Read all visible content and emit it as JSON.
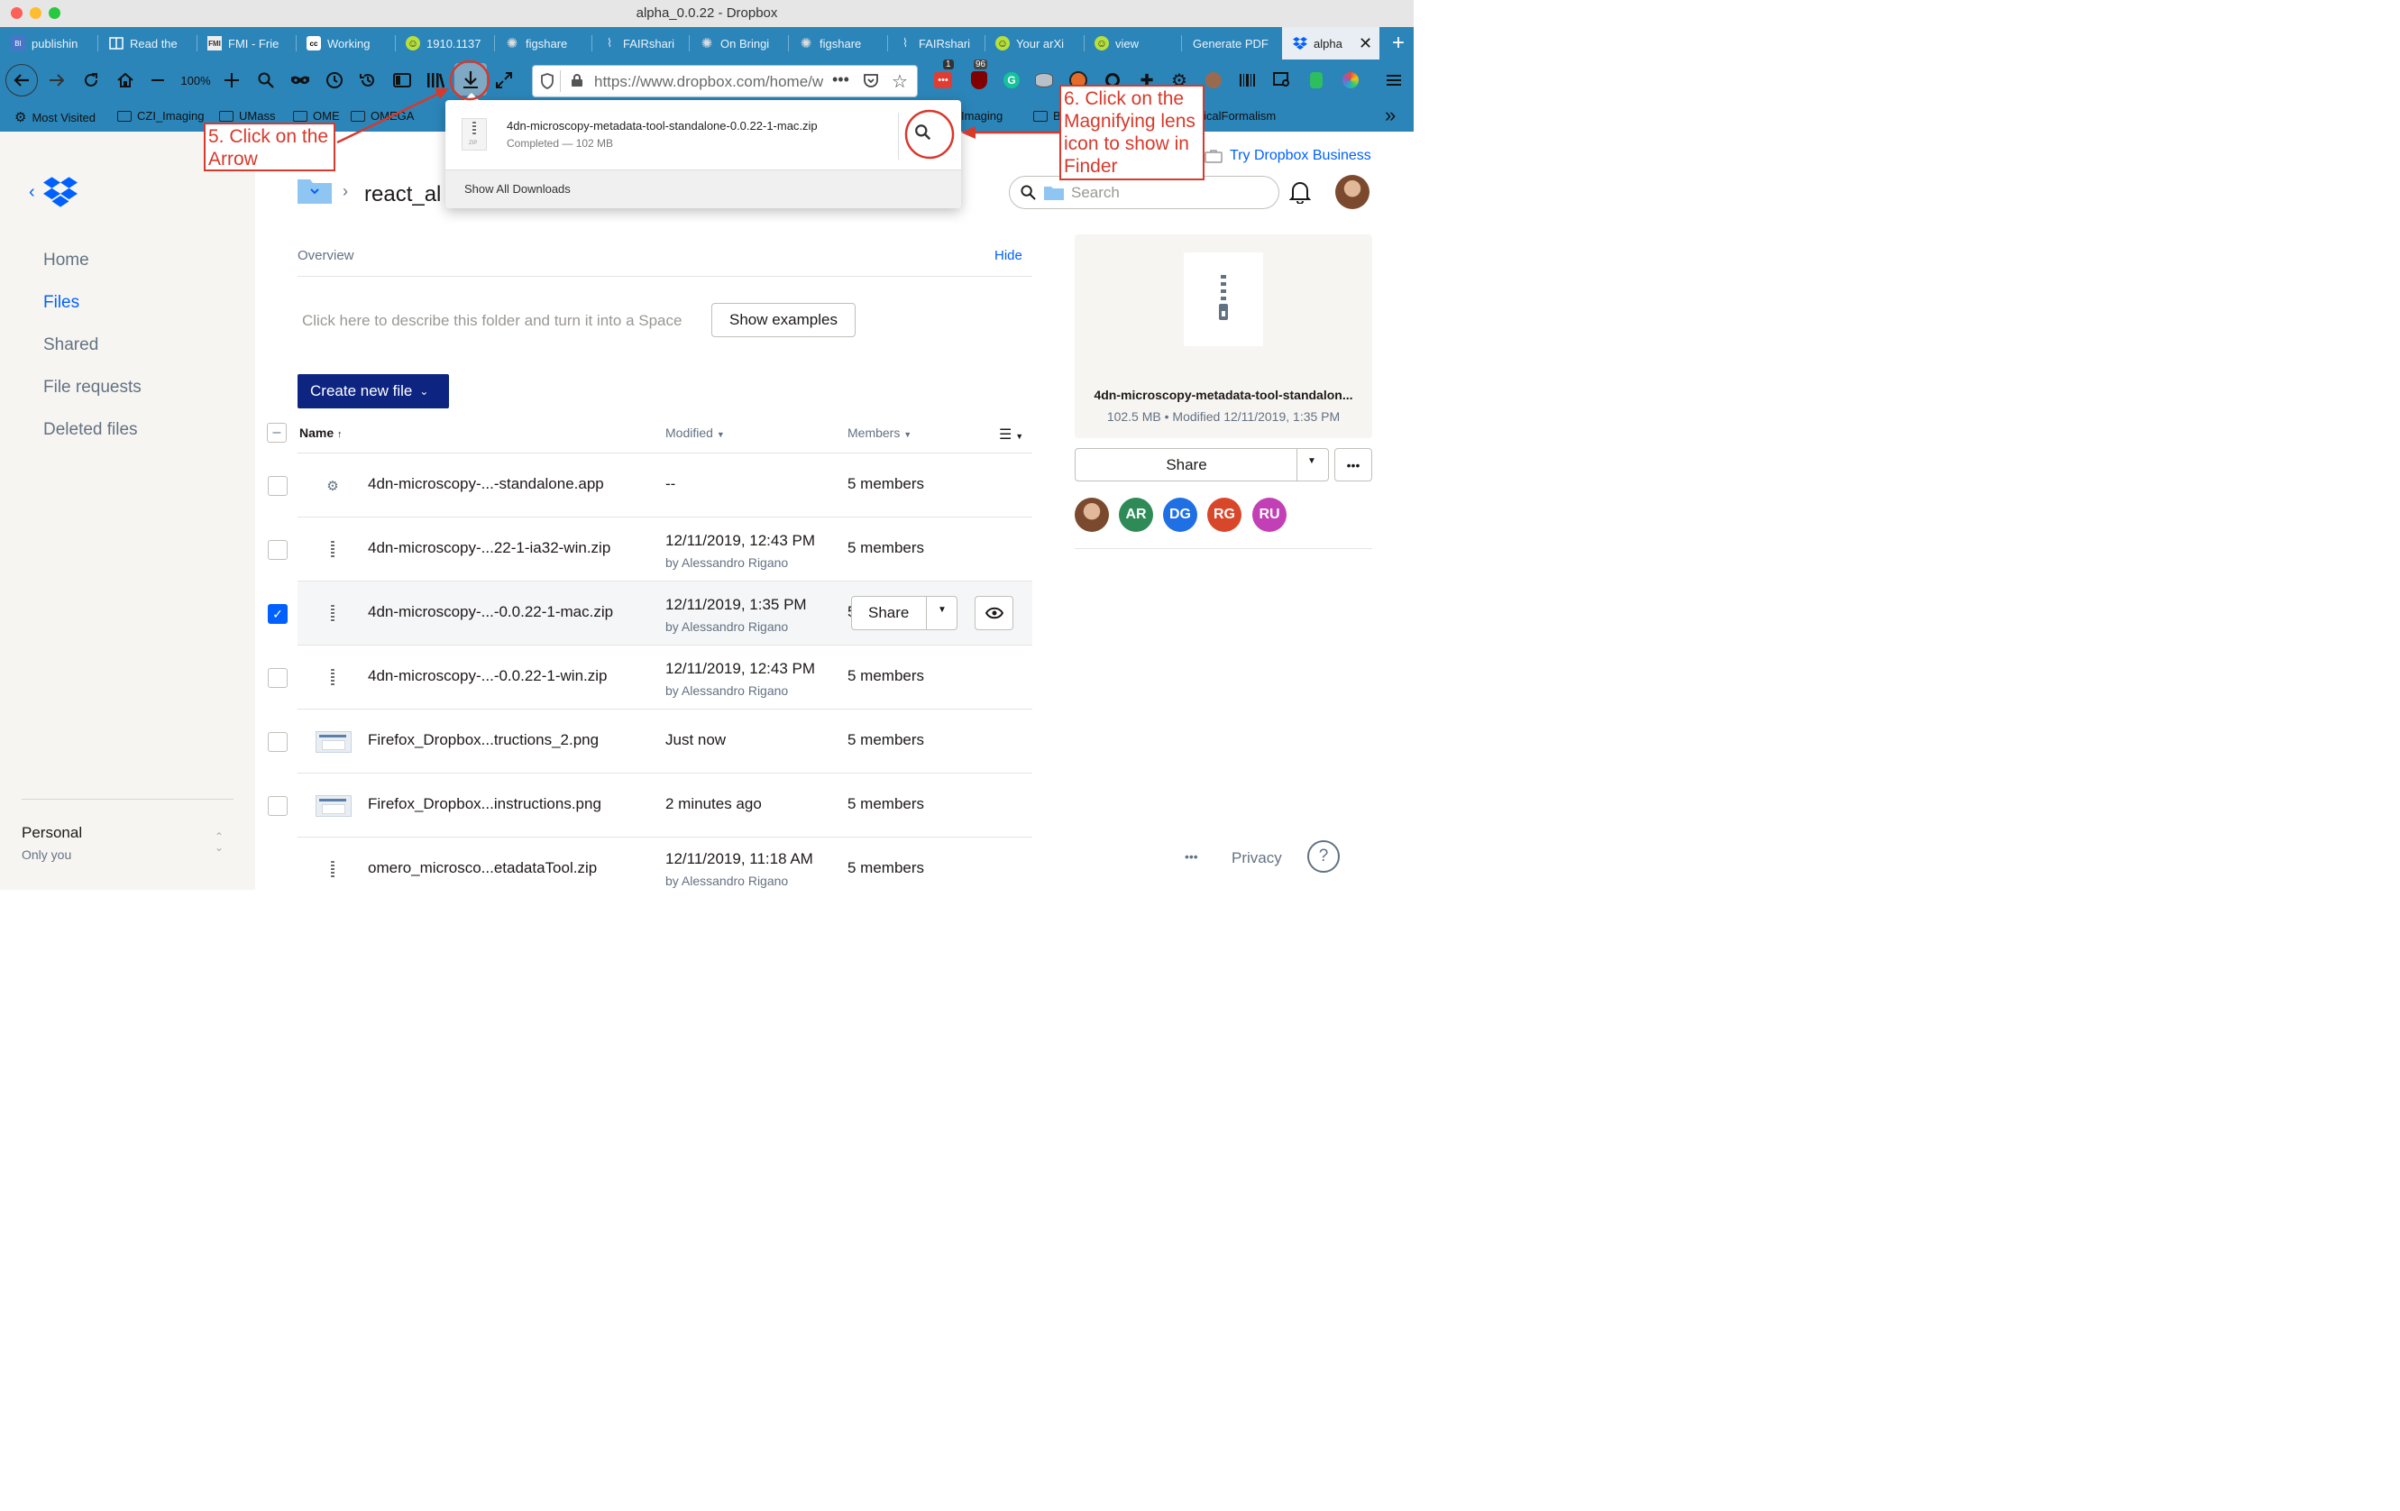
{
  "window": {
    "title": "alpha_0.0.22 - Dropbox"
  },
  "tabs": [
    {
      "label": "publishin",
      "icon": "bi-icon"
    },
    {
      "label": "Read the",
      "icon": "reader-icon"
    },
    {
      "label": "FMI - Frie",
      "icon": "fmi-icon"
    },
    {
      "label": "Working",
      "icon": "cc-icon"
    },
    {
      "label": "1910.1137",
      "icon": "smiley-icon"
    },
    {
      "label": "figshare",
      "icon": "figshare-icon"
    },
    {
      "label": "FAIRshari",
      "icon": "fairsharing-icon"
    },
    {
      "label": "On Bringi",
      "icon": "figshare-icon"
    },
    {
      "label": "figshare",
      "icon": "figshare-icon"
    },
    {
      "label": "FAIRshari",
      "icon": "fairsharing-icon"
    },
    {
      "label": "Your arXi",
      "icon": "smiley-icon"
    },
    {
      "label": "view",
      "icon": "smiley-icon"
    },
    {
      "label": "Generate PDF",
      "icon": ""
    },
    {
      "label": "alpha",
      "icon": "dropbox-icon",
      "active": true
    }
  ],
  "toolbar": {
    "zoom": "100%",
    "url": "https://www.dropbox.com/home/w",
    "badge_1": "1",
    "badge_96": "96"
  },
  "bookmarks": {
    "most_visited": "Most Visited",
    "czi": "CZI_Imaging",
    "umass": "UMass",
    "ome": "OME",
    "omega": "OMEGA",
    "imaging": "Imaging",
    "b": "B",
    "formalism": "icalFormalism"
  },
  "download_popup": {
    "filename": "4dn-microscopy-metadata-tool-standalone-0.0.22-1-mac.zip",
    "status": "Completed — 102 MB",
    "file_type": "ZIP",
    "show_all": "Show All Downloads"
  },
  "annotations": {
    "step5": "5. Click on the Arrow",
    "step6": "6. Click on the Magnifying lens icon to show in Finder"
  },
  "header": {
    "breadcrumb": "react_al",
    "try_business": "Try Dropbox Business",
    "search_placeholder": "Search"
  },
  "sidebar": {
    "items": [
      "Home",
      "Files",
      "Shared",
      "File requests",
      "Deleted files"
    ],
    "active": "Files",
    "account": "Personal",
    "account_sub": "Only you"
  },
  "overview": {
    "title": "Overview",
    "hide": "Hide",
    "describe": "Click here to describe this folder and turn it into a Space",
    "show_examples": "Show examples"
  },
  "create_button": "Create new file",
  "columns": {
    "name": "Name",
    "modified": "Modified",
    "members": "Members"
  },
  "files": [
    {
      "name": "4dn-microscopy-...-standalone.app",
      "modified": "--",
      "by": "",
      "members": "5 members",
      "type": "app",
      "selected": false
    },
    {
      "name": "4dn-microscopy-...22-1-ia32-win.zip",
      "modified": "12/11/2019, 12:43 PM",
      "by": "by Alessandro Rigano",
      "members": "5 members",
      "type": "zip",
      "selected": false
    },
    {
      "name": "4dn-microscopy-...-0.0.22-1-mac.zip",
      "modified": "12/11/2019, 1:35 PM",
      "by": "by Alessandro Rigano",
      "members": "5 members",
      "type": "zip",
      "selected": true
    },
    {
      "name": "4dn-microscopy-...-0.0.22-1-win.zip",
      "modified": "12/11/2019, 12:43 PM",
      "by": "by Alessandro Rigano",
      "members": "5 members",
      "type": "zip",
      "selected": false
    },
    {
      "name": "Firefox_Dropbox...tructions_2.png",
      "modified": "Just now",
      "by": "",
      "members": "5 members",
      "type": "png",
      "selected": false
    },
    {
      "name": "Firefox_Dropbox...instructions.png",
      "modified": "2 minutes ago",
      "by": "",
      "members": "5 members",
      "type": "png",
      "selected": false
    },
    {
      "name": "omero_microsco...etadataTool.zip",
      "modified": "12/11/2019, 11:18 AM",
      "by": "by Alessandro Rigano",
      "members": "5 members",
      "type": "zip",
      "selected": false
    }
  ],
  "row_share": "Share",
  "row_members_partial": "5",
  "preview": {
    "name": "4dn-microscopy-metadata-tool-standalon...",
    "meta": "102.5 MB • Modified 12/11/2019, 1:35 PM",
    "share": "Share",
    "more": "•••",
    "members": [
      {
        "initials": "",
        "color": "#8c5a3c"
      },
      {
        "initials": "AR",
        "color": "#2e8b57"
      },
      {
        "initials": "DG",
        "color": "#1f6fe5"
      },
      {
        "initials": "RG",
        "color": "#d9472b"
      },
      {
        "initials": "RU",
        "color": "#c33fb5"
      }
    ]
  },
  "footer": {
    "more": "•••",
    "privacy": "Privacy",
    "help": "?"
  }
}
